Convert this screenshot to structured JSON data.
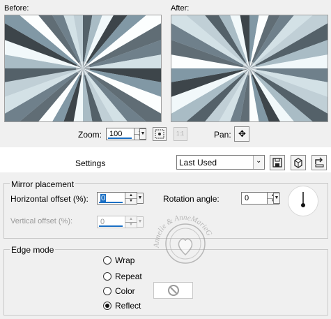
{
  "preview": {
    "before_label": "Before:",
    "after_label": "After:"
  },
  "zoom": {
    "label": "Zoom:",
    "value": "100",
    "fit_icon": "fit-to-window-icon",
    "actual_size_icon": "actual-size-icon",
    "actual_size_text": "1:1"
  },
  "pan": {
    "label": "Pan:",
    "icon": "move-arrows-icon"
  },
  "settings": {
    "label": "Settings",
    "preset_value": "Last Used",
    "save_icon": "save-disk-icon",
    "load_icon": "load-preset-icon",
    "reset_icon": "reset-icon"
  },
  "mirror": {
    "title": "Mirror placement",
    "horizontal_label": "Horizontal offset (%):",
    "horizontal_value": "0",
    "vertical_label": "Vertical offset (%):",
    "vertical_value": "0",
    "rotation_label": "Rotation angle:",
    "rotation_value": "0"
  },
  "edge": {
    "title": "Edge mode",
    "options": [
      "Wrap",
      "Repeat",
      "Color",
      "Reflect"
    ],
    "selected": "Reflect",
    "color_swatch_icon": "no-color-icon"
  },
  "watermark": {
    "text": "Annelie & AnneMarieG"
  },
  "colors": {
    "accent": "#1a6fc4",
    "sky_light": "#eaf6f9",
    "dark_ray": "#1e262c",
    "steel": "#6f8796"
  }
}
